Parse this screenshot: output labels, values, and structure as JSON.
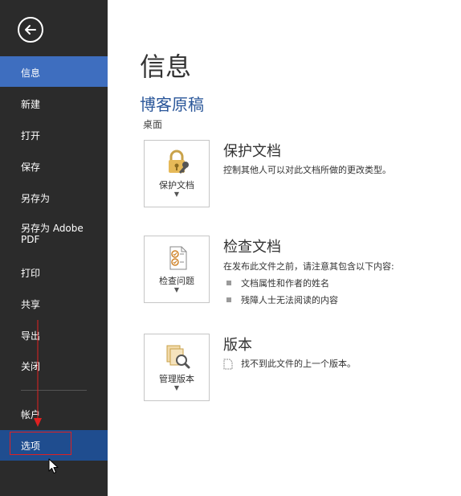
{
  "sidebar": {
    "items": [
      {
        "label": "信息",
        "state": "active"
      },
      {
        "label": "新建"
      },
      {
        "label": "打开"
      },
      {
        "label": "保存"
      },
      {
        "label": "另存为"
      },
      {
        "label": "另存为 Adobe PDF"
      },
      {
        "label": "打印"
      },
      {
        "label": "共享"
      },
      {
        "label": "导出"
      },
      {
        "label": "关闭"
      },
      {
        "label": "帐户"
      },
      {
        "label": "选项",
        "state": "hover"
      }
    ],
    "colors": {
      "background": "#2b2b2b",
      "active": "#3e6ebf",
      "hover": "#1f4d8f",
      "annotation": "#e02020"
    }
  },
  "main": {
    "page_title": "信息",
    "doc_title": "博客原稿",
    "doc_location": "桌面",
    "sections": [
      {
        "tile_label": "保护文档",
        "tile_icon": "lock-key-icon",
        "title": "保护文档",
        "description": "控制其他人可以对此文档所做的更改类型。"
      },
      {
        "tile_label": "检查问题",
        "tile_icon": "inspect-document-icon",
        "title": "检查文档",
        "description": "在发布此文件之前，请注意其包含以下内容:",
        "bullets": [
          "文档属性和作者的姓名",
          "残障人士无法阅读的内容"
        ]
      },
      {
        "tile_label": "管理版本",
        "tile_icon": "manage-versions-icon",
        "title": "版本",
        "description": "找不到此文件的上一个版本。"
      }
    ],
    "accent_color": "#2b579a"
  }
}
